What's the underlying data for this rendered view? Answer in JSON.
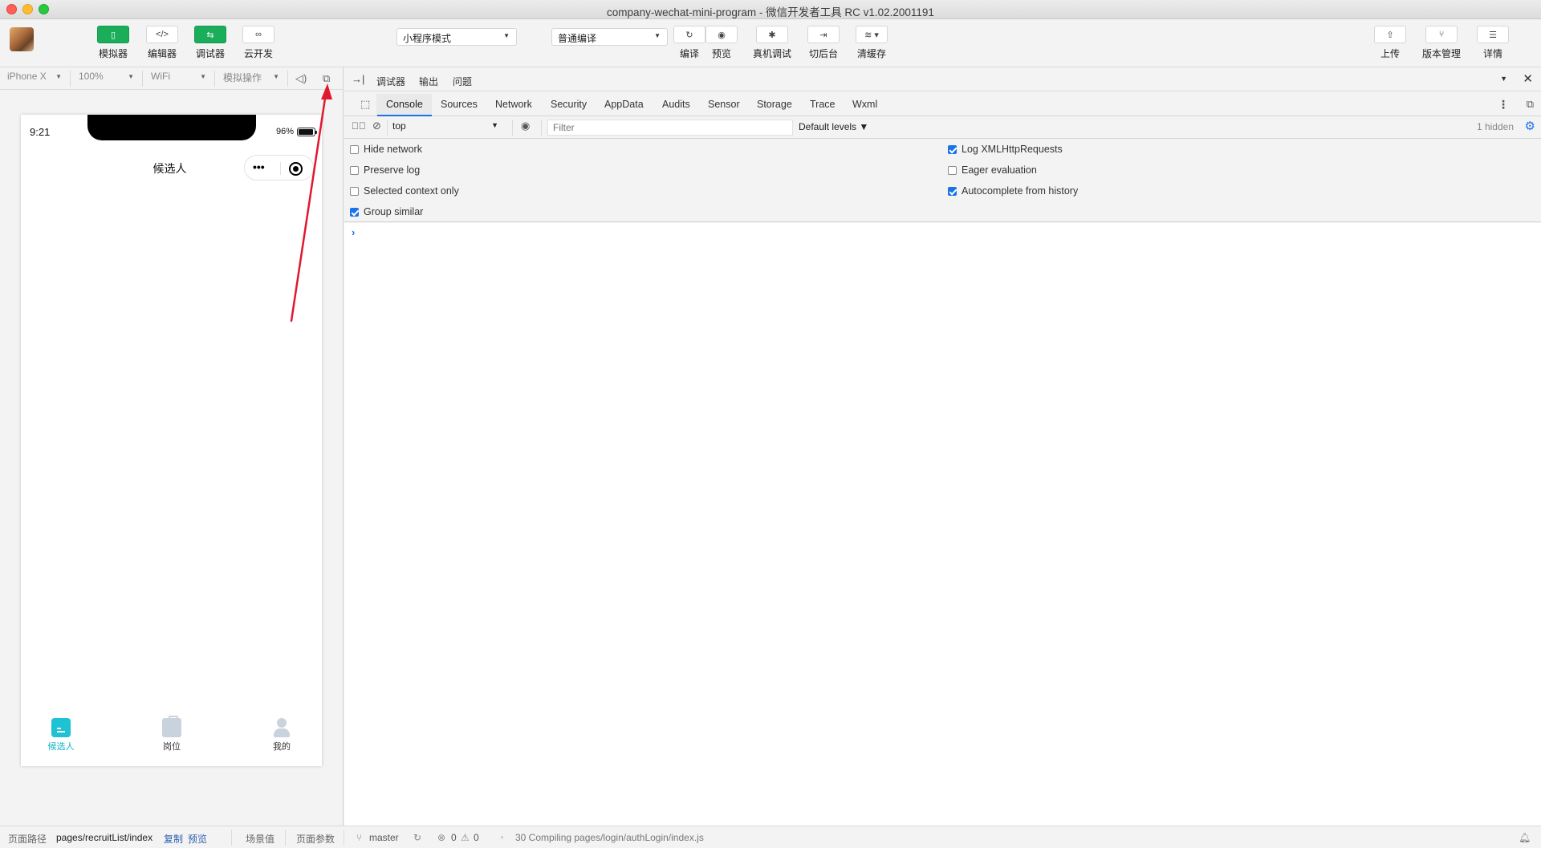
{
  "window": {
    "title": "company-wechat-mini-program - 微信开发者工具 RC v1.02.2001191"
  },
  "toolbar": {
    "simulator": "模拟器",
    "editor": "编辑器",
    "debugger": "调试器",
    "cloud": "云开发",
    "mode_select": "小程序模式",
    "compile_select": "普通编译",
    "compile": "编译",
    "preview": "预览",
    "remote_debug": "真机调试",
    "background": "切后台",
    "clear_cache": "清缓存",
    "upload": "上传",
    "version": "版本管理",
    "details": "详情",
    "editor_glyph": "</>"
  },
  "simbar": {
    "device": "iPhone X",
    "zoom": "100%",
    "network": "WiFi",
    "operation": "模拟操作"
  },
  "phone": {
    "time": "9:21",
    "battery": "96%",
    "battery_level": 0.96,
    "nav_title": "候选人",
    "capsule_dots": "•••",
    "tabs": [
      {
        "label": "候选人",
        "icon": "document-icon",
        "active": true
      },
      {
        "label": "岗位",
        "icon": "briefcase-icon",
        "active": false
      },
      {
        "label": "我的",
        "icon": "person-icon",
        "active": false
      }
    ]
  },
  "devtools": {
    "header_tabs": [
      "调试器",
      "输出",
      "问题"
    ],
    "panel_tabs": [
      "Console",
      "Sources",
      "Network",
      "Security",
      "AppData",
      "Audits",
      "Sensor",
      "Storage",
      "Trace",
      "Wxml"
    ],
    "context": "top",
    "filter_placeholder": "Filter",
    "levels": "Default levels ▼",
    "hidden": "1 hidden",
    "options_left": [
      {
        "label": "Hide network",
        "checked": false
      },
      {
        "label": "Preserve log",
        "checked": false
      },
      {
        "label": "Selected context only",
        "checked": false
      },
      {
        "label": "Group similar",
        "checked": true
      }
    ],
    "options_right": [
      {
        "label": "Log XMLHttpRequests",
        "checked": true
      },
      {
        "label": "Eager evaluation",
        "checked": false
      },
      {
        "label": "Autocomplete from history",
        "checked": true
      }
    ],
    "prompt": "›"
  },
  "statusbar": {
    "page_path_label": "页面路径",
    "page_path": "pages/recruitList/index",
    "copy": "复制",
    "preview": "预览",
    "scene": "场景值",
    "params": "页面参数",
    "branch": "master",
    "errors": "0",
    "warnings": "0",
    "compiling": "30 Compiling pages/login/authLogin/index.js"
  },
  "colors": {
    "accent_green": "#1aad5a",
    "tab_active": "#12b5c7",
    "devtools_blue": "#1a73e8",
    "annotation_arrow": "#e0182d"
  }
}
